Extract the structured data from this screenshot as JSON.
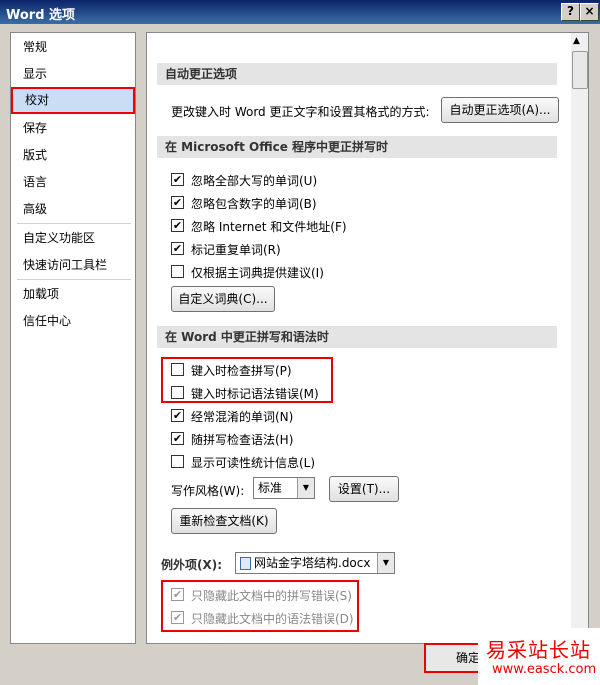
{
  "window": {
    "title": "Word 选项",
    "help_label": "?",
    "close_label": "×"
  },
  "sidebar": {
    "items": [
      {
        "label": "常规"
      },
      {
        "label": "显示"
      },
      {
        "label": "校对"
      },
      {
        "label": "保存"
      },
      {
        "label": "版式"
      },
      {
        "label": "语言"
      },
      {
        "label": "高级"
      },
      {
        "label": "自定义功能区"
      },
      {
        "label": "快速访问工具栏"
      },
      {
        "label": "加载项"
      },
      {
        "label": "信任中心"
      }
    ],
    "selected": "校对"
  },
  "autocorrect": {
    "header": "自动更正选项",
    "description": "更改键入时 Word 更正文字和设置其格式的方式:",
    "button": "自动更正选项(A)..."
  },
  "office_spelling": {
    "header": "在 Microsoft Office 程序中更正拼写时",
    "options": [
      {
        "label": "忽略全部大写的单词(U)",
        "checked": true
      },
      {
        "label": "忽略包含数字的单词(B)",
        "checked": true
      },
      {
        "label": "忽略 Internet 和文件地址(F)",
        "checked": true
      },
      {
        "label": "标记重复单词(R)",
        "checked": true
      },
      {
        "label": "仅根据主词典提供建议(I)",
        "checked": false
      }
    ],
    "dict_button": "自定义词典(C)..."
  },
  "word_spelling": {
    "header": "在 Word 中更正拼写和语法时",
    "options": [
      {
        "label": "键入时检查拼写(P)",
        "checked": false
      },
      {
        "label": "键入时标记语法错误(M)",
        "checked": false
      },
      {
        "label": "经常混淆的单词(N)",
        "checked": true
      },
      {
        "label": "随拼写检查语法(H)",
        "checked": true
      },
      {
        "label": "显示可读性统计信息(L)",
        "checked": false
      }
    ],
    "style_label": "写作风格(W):",
    "style_value": "标准",
    "settings_button": "设置(T)...",
    "recheck_button": "重新检查文档(K)"
  },
  "exceptions": {
    "label": "例外项(X):",
    "document": "网站金字塔结构.docx",
    "options": [
      {
        "label": "只隐藏此文档中的拼写错误(S)",
        "checked": true
      },
      {
        "label": "只隐藏此文档中的语法错误(D)",
        "checked": true
      }
    ]
  },
  "footer": {
    "ok_label": "确定"
  },
  "watermark": {
    "cn": "易采站长站",
    "url": "www.easck.com"
  },
  "check_glyph": "✔"
}
